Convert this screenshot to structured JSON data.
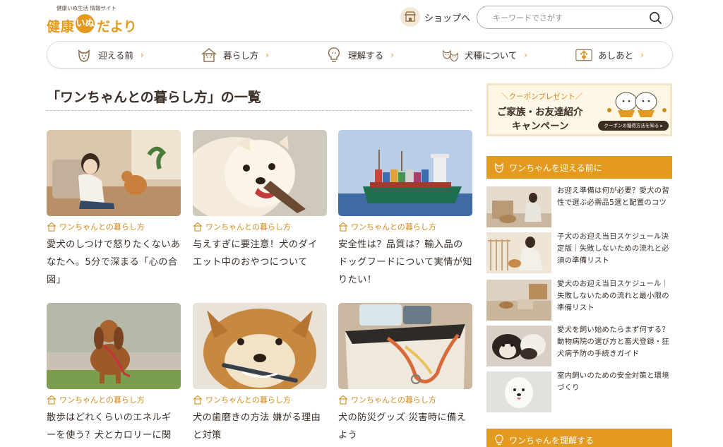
{
  "site": {
    "tagline": "健康いぬ生活 情報サイト",
    "logo_pre": "健康",
    "logo_inu": "いぬ",
    "logo_post": "だより"
  },
  "header": {
    "shop_label": "ショップへ",
    "search_placeholder": "キーワードでさがす"
  },
  "nav": [
    {
      "label": "迎える前",
      "icon": "dog-face-icon"
    },
    {
      "label": "暮らし方",
      "icon": "dog-house-icon"
    },
    {
      "label": "理解する",
      "icon": "lightbulb-icon"
    },
    {
      "label": "犬種について",
      "icon": "two-dogs-icon"
    },
    {
      "label": "あしあと",
      "icon": "paw-book-icon"
    }
  ],
  "main": {
    "title": "「ワンちゃんとの暮らし方」の一覧",
    "cards": [
      {
        "category": "ワンちゃんとの暮らし方",
        "title": "愛犬のしつけで怒りたくないあなたへ。5分で深まる「心の合図」"
      },
      {
        "category": "ワンちゃんとの暮らし方",
        "title": "与えすぎに要注意！犬のダイエット中のおやつについて"
      },
      {
        "category": "ワンちゃんとの暮らし方",
        "title": "安全性は？品質は？輸入品のドッグフードについて実情が知りたい！"
      },
      {
        "category": "ワンちゃんとの暮らし方",
        "title": "散歩はどれくらいのエネルギーを使う？犬とカロリーに関"
      },
      {
        "category": "ワンちゃんとの暮らし方",
        "title": "犬の歯磨きの方法 嫌がる理由と対策"
      },
      {
        "category": "ワンちゃんとの暮らし方",
        "title": "犬の防災グッズ 災害時に備えよう"
      }
    ]
  },
  "sidebar": {
    "banner": {
      "line1": "＼クーポンプレゼント／",
      "line2": "ご家族・お友達紹介",
      "line3": "キャンペーン",
      "button": "クーポンの獲得方法を知る ▸"
    },
    "section1_title": "ワンちゃんを迎える前に",
    "section2_title": "ワンちゃんを理解する",
    "items": [
      {
        "title": "お迎え準備は何が必要？愛犬の習性で選ぶ必需品5選と配置のコツ"
      },
      {
        "title": "子犬のお迎え当日スケジュール決定版｜失敗しないための流れと必須の準備リスト"
      },
      {
        "title": "愛犬のお迎え当日スケジュール｜失敗しないための流れと最小限の準備リスト"
      },
      {
        "title": "愛犬を飼い始めたらまず何する？動物病院の選び方と畜犬登録・狂犬病予防の手続きガイド"
      },
      {
        "title": "室内飼いのための安全対策と環境づくり"
      }
    ]
  },
  "colors": {
    "accent": "#e39a1e",
    "text": "#3a2e26",
    "banner_bg": "#fff7e6"
  }
}
